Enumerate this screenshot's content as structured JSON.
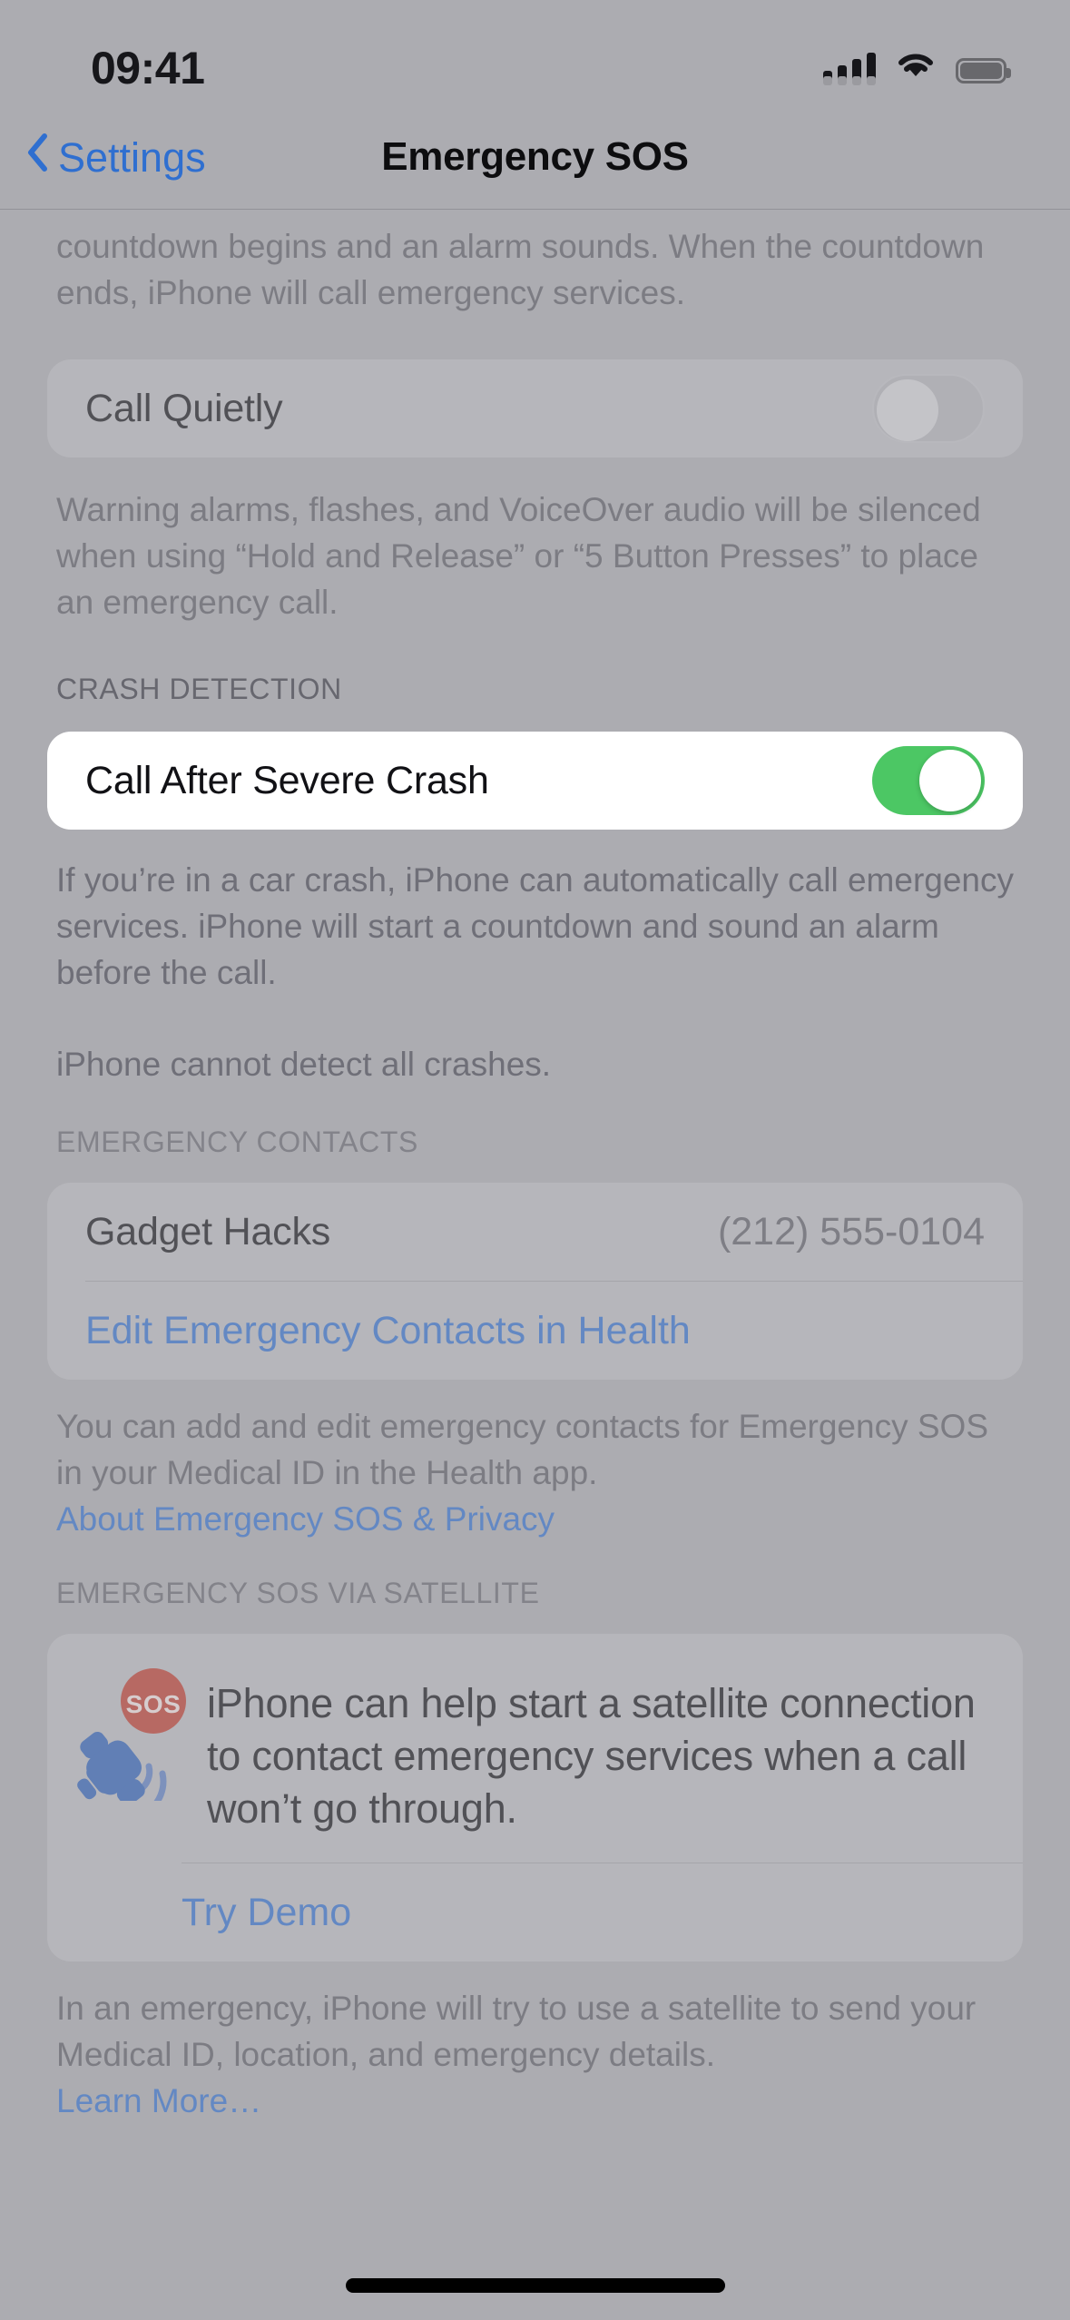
{
  "status_bar": {
    "time": "09:41",
    "cellular_icon": "cellular-signal-icon",
    "wifi_icon": "wifi-icon",
    "battery_icon": "battery-icon"
  },
  "nav": {
    "back_label": "Settings",
    "back_icon": "chevron-left-icon",
    "title": "Emergency SOS"
  },
  "sections": {
    "call_quietly": {
      "footer_above": "countdown begins and an alarm sounds. When the countdown ends, iPhone will call emergency services.",
      "row_label": "Call Quietly",
      "toggle_state": "off",
      "footer": "Warning alarms, flashes, and VoiceOver audio will be silenced when using “Hold and Release” or “5 Button Presses” to place an emergency call."
    },
    "crash_detection": {
      "header": "CRASH DETECTION",
      "row_label": "Call After Severe Crash",
      "toggle_state": "on",
      "footer_1": "If you’re in a car crash, iPhone can automatically call emergency services. iPhone will start a countdown and sound an alarm before the call.",
      "footer_2": "iPhone cannot detect all crashes."
    },
    "emergency_contacts": {
      "header": "EMERGENCY CONTACTS",
      "contacts": [
        {
          "name": "Gadget Hacks",
          "phone": "(212) 555-0104"
        }
      ],
      "edit_link": "Edit Emergency Contacts in Health",
      "footer": "You can add and edit emergency contacts for Emergency SOS in your Medical ID in the Health app.",
      "footer_link": "About Emergency SOS & Privacy"
    },
    "satellite": {
      "header": "EMERGENCY SOS VIA SATELLITE",
      "icon": "satellite-sos-icon",
      "promo_text": "iPhone can help start a satellite connection to contact emergency services when a call won’t go through.",
      "demo_link": "Try Demo",
      "footer": "In an emergency, iPhone will try to use a satellite to send your Medical ID, location, and emergency details.",
      "footer_link": "Learn More…"
    }
  },
  "home_indicator": "home-indicator",
  "colors": {
    "accent_blue": "#2f6fd0",
    "toggle_on_green": "#4CC764",
    "sos_red": "#C0392B",
    "satellite_blue": "#2C5FB8",
    "dim_background": "#ACACB1",
    "highlight_background": "#F0F0F4"
  }
}
